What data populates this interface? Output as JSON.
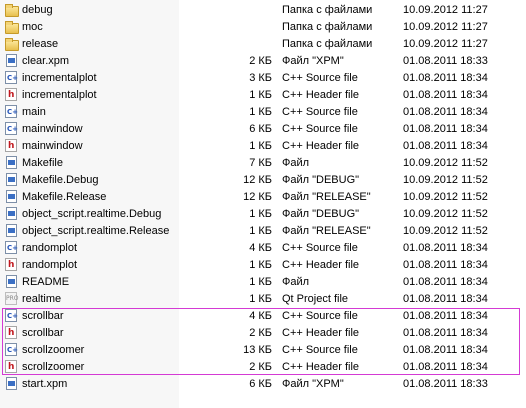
{
  "files": [
    {
      "name": "debug",
      "size": "",
      "type": "Папка с файлами",
      "date": "10.09.2012 11:27",
      "icon": "folder-icon"
    },
    {
      "name": "moc",
      "size": "",
      "type": "Папка с файлами",
      "date": "10.09.2012 11:27",
      "icon": "folder-icon"
    },
    {
      "name": "release",
      "size": "",
      "type": "Папка с файлами",
      "date": "10.09.2012 11:27",
      "icon": "folder-icon"
    },
    {
      "name": "clear.xpm",
      "size": "2 КБ",
      "type": "Файл \"XPM\"",
      "date": "01.08.2011 18:33",
      "icon": "image-file-icon"
    },
    {
      "name": "incrementalplot",
      "size": "3 КБ",
      "type": "C++ Source file",
      "date": "01.08.2011 18:34",
      "icon": "cpp-source-icon"
    },
    {
      "name": "incrementalplot",
      "size": "1 КБ",
      "type": "C++ Header file",
      "date": "01.08.2011 18:34",
      "icon": "cpp-header-icon"
    },
    {
      "name": "main",
      "size": "1 КБ",
      "type": "C++ Source file",
      "date": "01.08.2011 18:34",
      "icon": "cpp-source-icon"
    },
    {
      "name": "mainwindow",
      "size": "6 КБ",
      "type": "C++ Source file",
      "date": "01.08.2011 18:34",
      "icon": "cpp-source-icon"
    },
    {
      "name": "mainwindow",
      "size": "1 КБ",
      "type": "C++ Header file",
      "date": "01.08.2011 18:34",
      "icon": "cpp-header-icon"
    },
    {
      "name": "Makefile",
      "size": "7 КБ",
      "type": "Файл",
      "date": "10.09.2012 11:52",
      "icon": "generic-file-icon"
    },
    {
      "name": "Makefile.Debug",
      "size": "12 КБ",
      "type": "Файл \"DEBUG\"",
      "date": "10.09.2012 11:52",
      "icon": "generic-file-icon"
    },
    {
      "name": "Makefile.Release",
      "size": "12 КБ",
      "type": "Файл \"RELEASE\"",
      "date": "10.09.2012 11:52",
      "icon": "generic-file-icon"
    },
    {
      "name": "object_script.realtime.Debug",
      "size": "1 КБ",
      "type": "Файл \"DEBUG\"",
      "date": "10.09.2012 11:52",
      "icon": "generic-file-icon"
    },
    {
      "name": "object_script.realtime.Release",
      "size": "1 КБ",
      "type": "Файл \"RELEASE\"",
      "date": "10.09.2012 11:52",
      "icon": "generic-file-icon"
    },
    {
      "name": "randomplot",
      "size": "4 КБ",
      "type": "C++ Source file",
      "date": "01.08.2011 18:34",
      "icon": "cpp-source-icon"
    },
    {
      "name": "randomplot",
      "size": "1 КБ",
      "type": "C++ Header file",
      "date": "01.08.2011 18:34",
      "icon": "cpp-header-icon"
    },
    {
      "name": "README",
      "size": "1 КБ",
      "type": "Файл",
      "date": "01.08.2011 18:34",
      "icon": "generic-file-icon"
    },
    {
      "name": "realtime",
      "size": "1 КБ",
      "type": "Qt Project file",
      "date": "01.08.2011 18:34",
      "icon": "qt-project-icon"
    },
    {
      "name": "scrollbar",
      "size": "4 КБ",
      "type": "C++ Source file",
      "date": "01.08.2011 18:34",
      "icon": "cpp-source-icon"
    },
    {
      "name": "scrollbar",
      "size": "2 КБ",
      "type": "C++ Header file",
      "date": "01.08.2011 18:34",
      "icon": "cpp-header-icon"
    },
    {
      "name": "scrollzoomer",
      "size": "13 КБ",
      "type": "C++ Source file",
      "date": "01.08.2011 18:34",
      "icon": "cpp-source-icon"
    },
    {
      "name": "scrollzoomer",
      "size": "2 КБ",
      "type": "C++ Header file",
      "date": "01.08.2011 18:34",
      "icon": "cpp-header-icon"
    },
    {
      "name": "start.xpm",
      "size": "6 КБ",
      "type": "Файл \"XPM\"",
      "date": "01.08.2011 18:33",
      "icon": "image-file-icon"
    }
  ],
  "highlight_color": "#d43ad4"
}
